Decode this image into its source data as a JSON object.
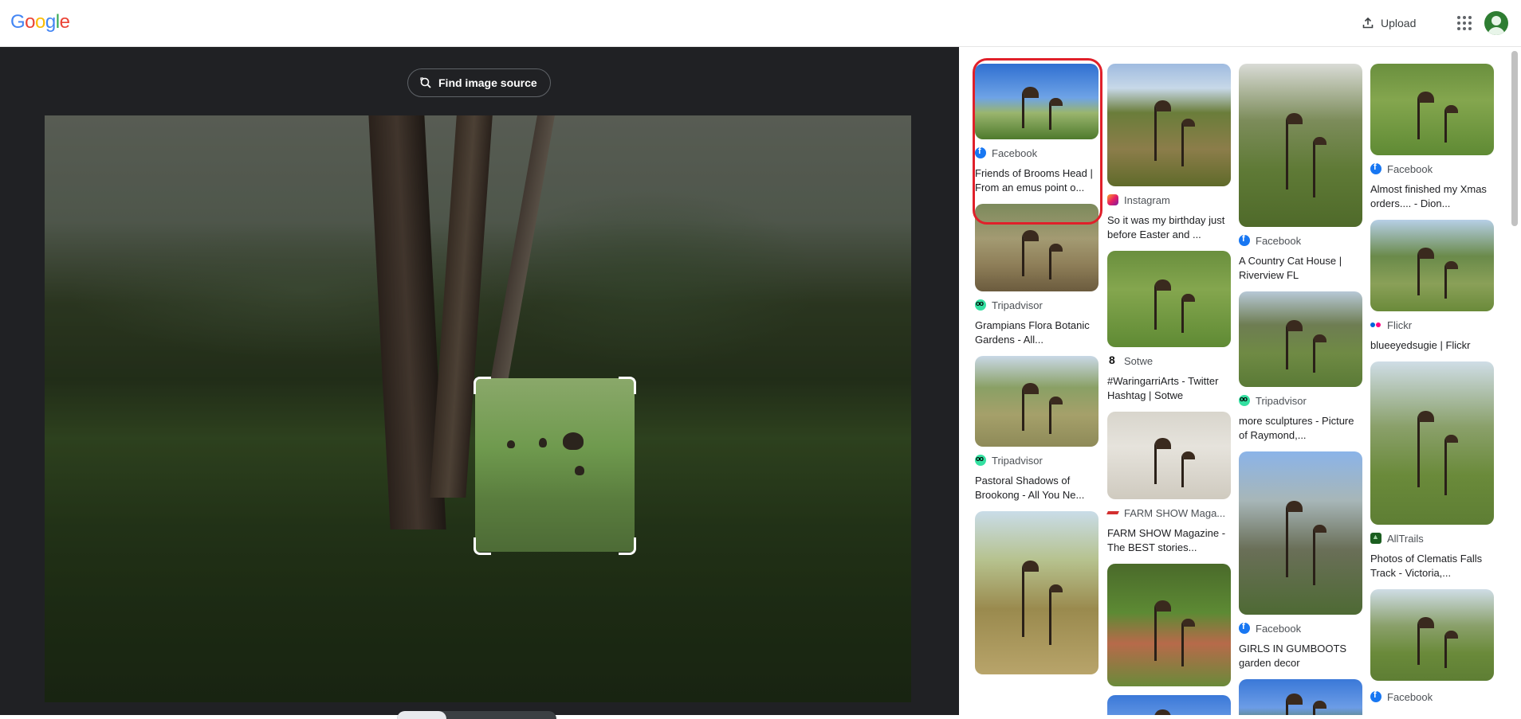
{
  "header": {
    "logo_letters": [
      {
        "ch": "G",
        "color": "#4285F4"
      },
      {
        "ch": "o",
        "color": "#EA4335"
      },
      {
        "ch": "o",
        "color": "#FBBC05"
      },
      {
        "ch": "g",
        "color": "#4285F4"
      },
      {
        "ch": "l",
        "color": "#34A853"
      },
      {
        "ch": "e",
        "color": "#EA4335"
      }
    ],
    "upload_label": "Upload",
    "upload_icon": "upload-icon",
    "apps_icon": "apps-grid-icon",
    "avatar_icon": "account-avatar"
  },
  "viewer": {
    "find_source_label": "Find image source",
    "find_source_icon": "lens-search-icon"
  },
  "results": {
    "columns": [
      [
        {
          "source": "Facebook",
          "favicon": "facebook",
          "title": "Friends of Brooms Head | From an emus point o...",
          "thumb": "t-sky",
          "h": 95,
          "selected": true
        },
        {
          "source": "Tripadvisor",
          "favicon": "tripadvisor",
          "title": "Grampians Flora Botanic Gardens - All...",
          "thumb": "t-park",
          "h": 110
        },
        {
          "source": "Tripadvisor",
          "favicon": "tripadvisor",
          "title": "Pastoral Shadows of Brookong - All You Ne...",
          "thumb": "t-dry",
          "h": 114
        },
        {
          "source": "",
          "favicon": "",
          "title": "",
          "thumb": "t-crane",
          "h": 205
        }
      ],
      [
        {
          "source": "Instagram",
          "favicon": "instagram",
          "title": "So it was my birthday just before Easter and ...",
          "thumb": "t-field",
          "h": 154
        },
        {
          "source": "Sotwe",
          "favicon": "sotwe",
          "title": "#WaringarriArts - Twitter Hashtag | Sotwe",
          "thumb": "t-lawn",
          "h": 121
        },
        {
          "source": "FARM SHOW Maga...",
          "favicon": "farmshow",
          "title": "FARM SHOW Magazine - The BEST stories...",
          "thumb": "t-gravel",
          "h": 110
        },
        {
          "source": "",
          "favicon": "",
          "title": "",
          "thumb": "t-garden",
          "h": 154
        },
        {
          "source": "",
          "favicon": "",
          "title": "",
          "thumb": "t-blue",
          "h": 60
        }
      ],
      [
        {
          "source": "Facebook",
          "favicon": "facebook",
          "title": "A Country Cat House | Riverview FL",
          "thumb": "t-tree",
          "h": 205
        },
        {
          "source": "Tripadvisor",
          "favicon": "tripadvisor",
          "title": "more sculptures - Picture of Raymond,...",
          "thumb": "t-bush",
          "h": 120
        },
        {
          "source": "Facebook",
          "favicon": "facebook",
          "title": "GIRLS IN GUMBOOTS garden decor",
          "thumb": "t-dark",
          "h": 205
        },
        {
          "source": "",
          "favicon": "",
          "title": "",
          "thumb": "t-blue",
          "h": 60
        }
      ],
      [
        {
          "source": "Facebook",
          "favicon": "facebook",
          "title": "Almost finished my Xmas orders.... - Dion...",
          "thumb": "t-lawn",
          "h": 115
        },
        {
          "source": "Flickr",
          "favicon": "flickr",
          "title": "blueeyedsugie | Flickr",
          "thumb": "t-marsh",
          "h": 115
        },
        {
          "source": "AllTrails",
          "favicon": "alltrails",
          "title": "Photos of Clematis Falls Track - Victoria,...",
          "thumb": "t-hill",
          "h": 205
        },
        {
          "source": "",
          "favicon": "",
          "title": "",
          "thumb": "t-hill",
          "h": 115
        },
        {
          "source": "Facebook",
          "favicon": "facebook",
          "title": "",
          "thumb": "",
          "h": 0
        }
      ]
    ]
  }
}
